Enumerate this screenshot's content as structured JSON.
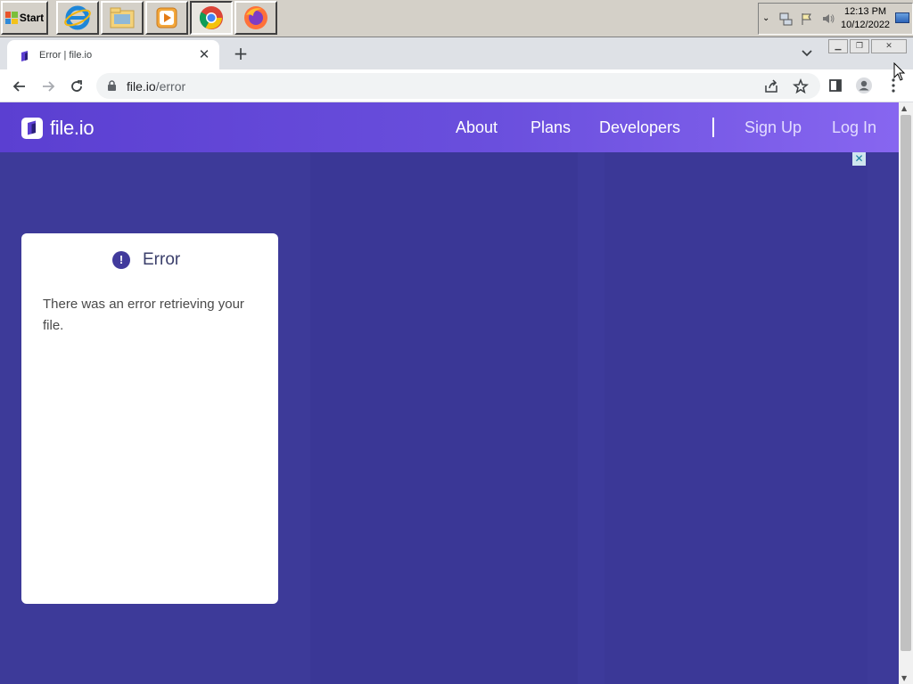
{
  "taskbar": {
    "start_label": "Start",
    "apps": [
      {
        "name": "internet-explorer-icon",
        "active": false
      },
      {
        "name": "file-explorer-icon",
        "active": false
      },
      {
        "name": "media-player-icon",
        "active": false
      },
      {
        "name": "chrome-icon",
        "active": true
      },
      {
        "name": "firefox-icon",
        "active": false
      }
    ],
    "clock_time": "12:13 PM",
    "clock_date": "10/12/2022"
  },
  "browser": {
    "tab_title": "Error | file.io",
    "url_host": "file.io",
    "url_path": "/error"
  },
  "site": {
    "logo_text": "file.io",
    "nav": {
      "about": "About",
      "plans": "Plans",
      "developers": "Developers",
      "sign_up": "Sign Up",
      "log_in": "Log In"
    },
    "error_card": {
      "title": "Error",
      "icon_glyph": "!",
      "message": "There was an error retrieving your file."
    },
    "ad_close_glyph": "✕"
  },
  "colors": {
    "page_bg": "#3d3a99",
    "header_start": "#5b3fd1",
    "header_end": "#8766f0",
    "error_icon": "#413a9c"
  }
}
